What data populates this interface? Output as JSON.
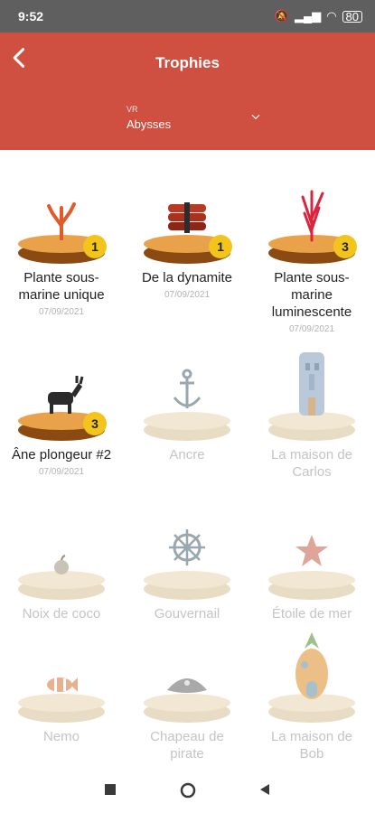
{
  "status": {
    "time": "9:52",
    "battery": "80"
  },
  "header": {
    "title": "Trophies",
    "back_icon": "back-arrow-icon"
  },
  "selector": {
    "label": "VR",
    "value": "Abysses",
    "icon": "chevron-down-icon"
  },
  "trophies": [
    {
      "name": "Plante sous-marine unique",
      "date": "07/09/2021",
      "count": "1",
      "earned": true,
      "icon": "coral-icon"
    },
    {
      "name": "De la dynamite",
      "date": "07/09/2021",
      "count": "1",
      "earned": true,
      "icon": "dynamite-icon"
    },
    {
      "name": "Plante sous-marine luminescente",
      "date": "07/09/2021",
      "count": "3",
      "earned": true,
      "icon": "red-seaweed-icon"
    },
    {
      "name": "Âne plongeur #2",
      "date": "07/09/2021",
      "count": "3",
      "earned": true,
      "icon": "donkey-icon"
    },
    {
      "name": "Ancre",
      "earned": false,
      "icon": "anchor-icon"
    },
    {
      "name": "La maison de Carlos",
      "earned": false,
      "icon": "stone-head-house-icon"
    },
    {
      "name": "Noix de coco",
      "earned": false,
      "icon": "coconut-icon"
    },
    {
      "name": "Gouvernail",
      "earned": false,
      "icon": "ship-wheel-icon"
    },
    {
      "name": "Étoile de mer",
      "earned": false,
      "icon": "starfish-icon"
    },
    {
      "name": "Nemo",
      "earned": false,
      "icon": "clownfish-icon"
    },
    {
      "name": "Chapeau de pirate",
      "earned": false,
      "icon": "pirate-hat-icon"
    },
    {
      "name": "La maison de Bob",
      "earned": false,
      "icon": "pineapple-house-icon"
    }
  ],
  "colors": {
    "header": "#cf4f40",
    "badge": "#f3c51c",
    "earned_base": "#e9a24a",
    "locked_base": "#f1e7d3"
  }
}
